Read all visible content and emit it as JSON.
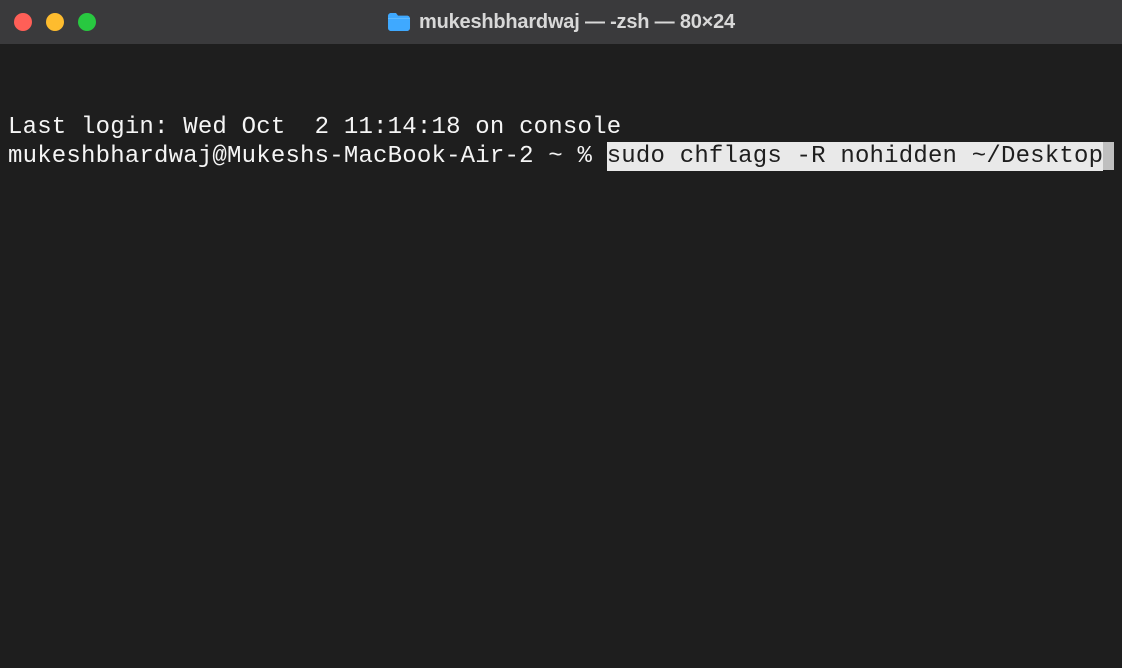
{
  "titlebar": {
    "title": "mukeshbhardwaj — -zsh — 80×24",
    "icon": "folder-icon"
  },
  "terminal": {
    "last_login_line": "Last login: Wed Oct  2 11:14:18 on console",
    "prompt": "mukeshbhardwaj@Mukeshs-MacBook-Air-2 ~ % ",
    "command_highlighted": "sudo chflags -R nohidden ~/Desktop"
  },
  "colors": {
    "bg": "#1e1e1e",
    "titlebar_bg": "#3a3a3c",
    "text": "#f5f5f5",
    "highlight_bg": "#e9e9e9",
    "highlight_fg": "#1e1e1e",
    "traffic_red": "#ff5f57",
    "traffic_yellow": "#febc2e",
    "traffic_green": "#28c840",
    "folder_blue": "#3fa9ff"
  }
}
